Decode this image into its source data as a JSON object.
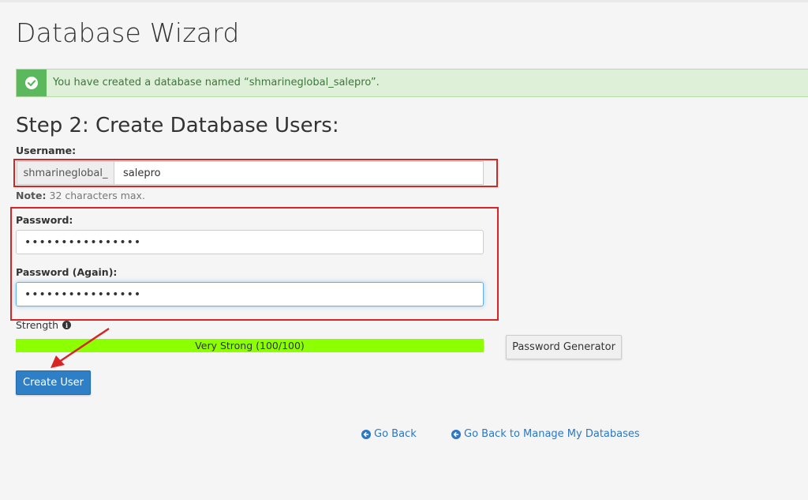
{
  "page": {
    "title": "Database Wizard"
  },
  "alert": {
    "message": "You have created a database named “shmarineglobal_salepro”.",
    "icon": "check-circle-icon",
    "color": "#5cb85c"
  },
  "step": {
    "title": "Step 2: Create Database Users:"
  },
  "username": {
    "label": "Username:",
    "prefix": "shmarineglobal_",
    "value": "salepro",
    "note_bold": "Note:",
    "note_text": " 32 characters max."
  },
  "password": {
    "label": "Password:",
    "value": "••••••••••••••••"
  },
  "password_again": {
    "label": "Password (Again):",
    "value": "••••••••••••••••"
  },
  "strength": {
    "label": "Strength",
    "text": "Very Strong (100/100)",
    "value": 100,
    "max": 100,
    "color": "#8cff00",
    "info_icon": "info-circle-icon"
  },
  "buttons": {
    "generator": "Password Generator",
    "create": "Create User"
  },
  "links": {
    "go_back": "Go Back",
    "go_back_manage": "Go Back to Manage My Databases"
  },
  "annotations": {
    "highlight_color": "#d72525",
    "arrow_color": "#d72525"
  }
}
